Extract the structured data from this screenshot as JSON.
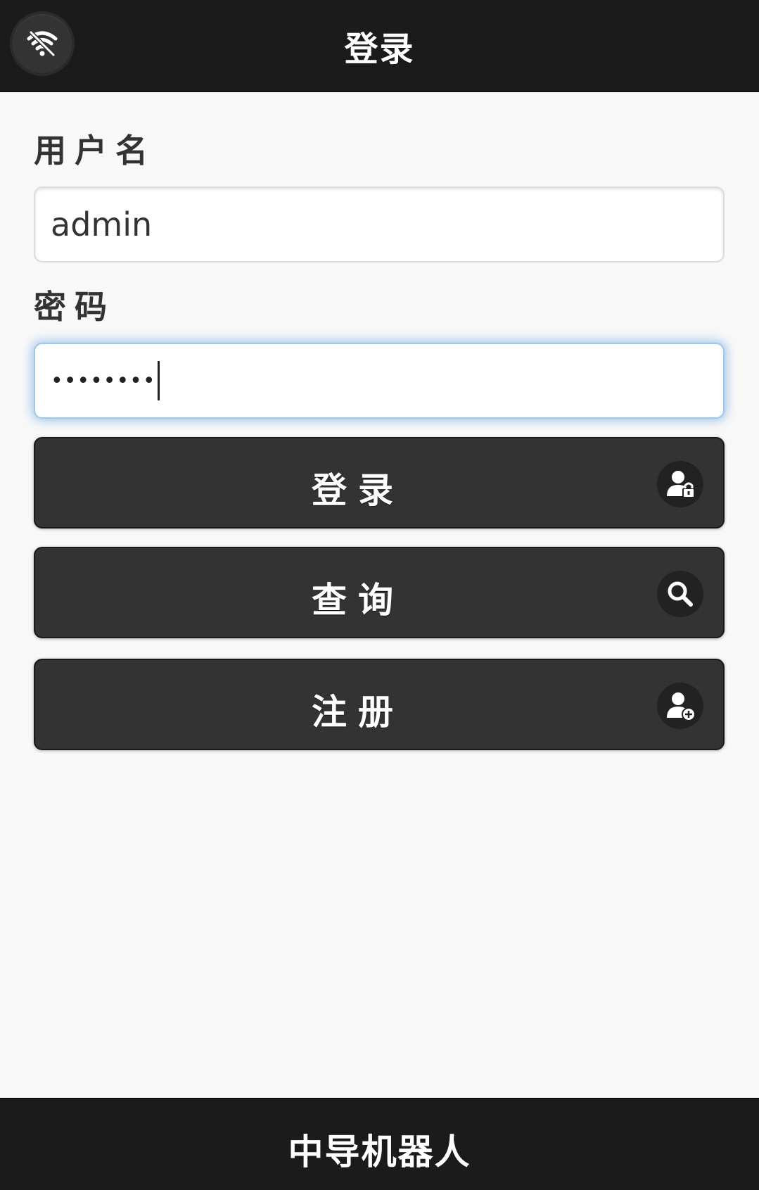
{
  "header": {
    "title": "登录",
    "wifi_icon": "wifi-off-icon"
  },
  "form": {
    "username_label": "用户名",
    "username_value": "admin",
    "password_label": "密码",
    "password_value": "••••••••"
  },
  "buttons": {
    "login": {
      "label": "登录",
      "icon": "user-lock-icon"
    },
    "query": {
      "label": "查询",
      "icon": "search-icon"
    },
    "register": {
      "label": "注册",
      "icon": "user-add-icon"
    }
  },
  "footer": {
    "title": "中导机器人"
  },
  "colors": {
    "bar_background": "#1b1b1b",
    "button_background": "#333333",
    "page_background": "#f8f8f8",
    "focus_glow": "#388cdc"
  }
}
